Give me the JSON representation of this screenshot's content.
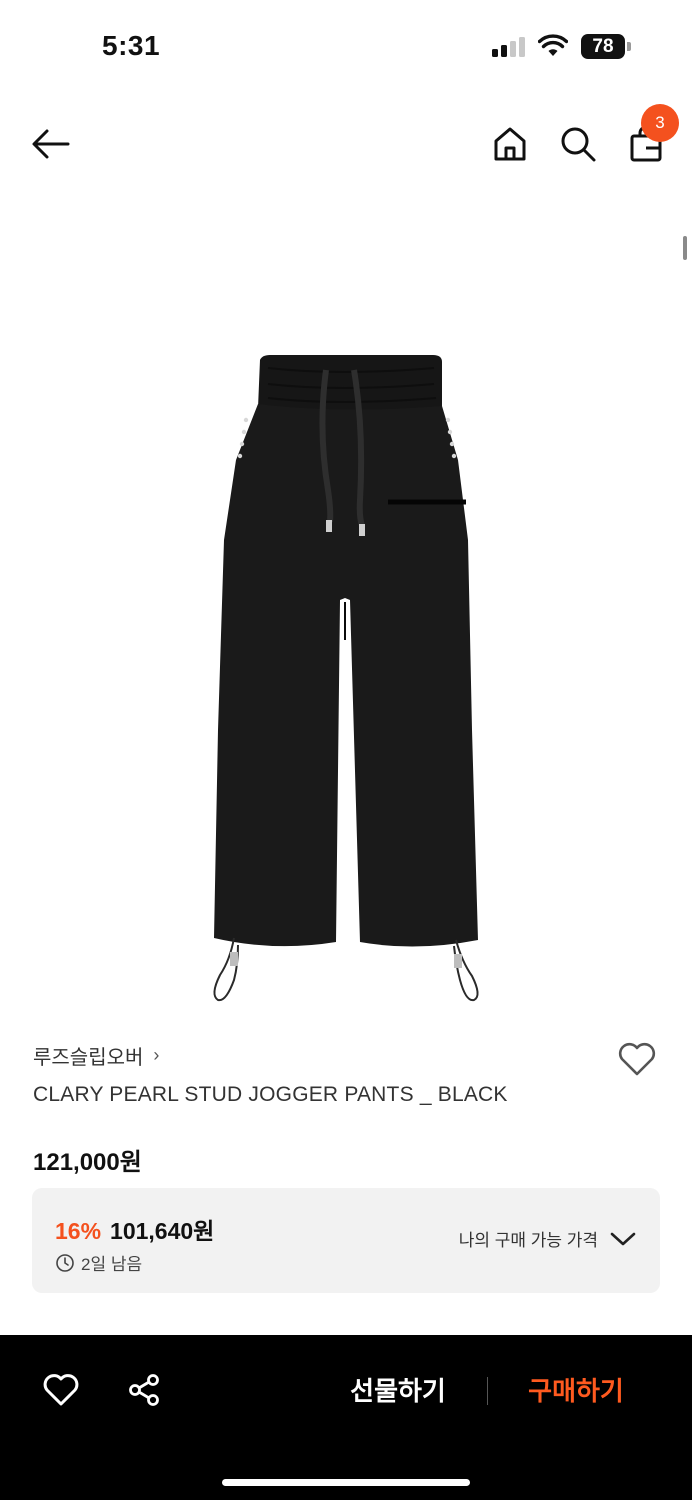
{
  "status_bar": {
    "time": "5:31",
    "battery": "78"
  },
  "header": {
    "cart_count": "3"
  },
  "product": {
    "brand": "루즈슬립오버",
    "brand_chevron": "›",
    "name": "CLARY PEARL STUD JOGGER PANTS _ BLACK",
    "original_price": "121,000원",
    "discount_rate": "16%",
    "sale_price": "101,640원",
    "time_left": "2일 남음",
    "my_price_label": "나의 구매 가능 가격"
  },
  "bottom_bar": {
    "gift_label": "선물하기",
    "buy_label": "구매하기"
  },
  "colors": {
    "accent": "#f4511e",
    "buy_text": "#ff5a1f",
    "background": "#ffffff",
    "panel": "#f2f2f2"
  }
}
